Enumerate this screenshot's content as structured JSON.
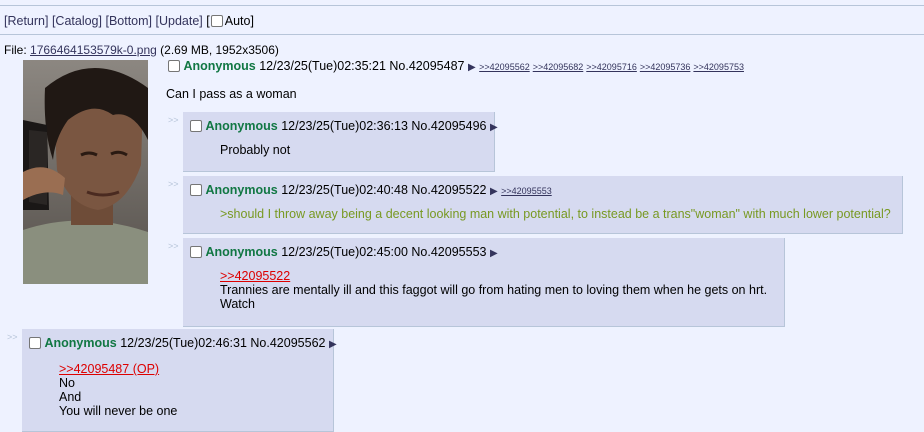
{
  "nav": {
    "return": "[Return]",
    "catalog": "[Catalog]",
    "bottom": "[Bottom]",
    "update": "[Update]",
    "auto_open": "[",
    "auto_label": "Auto]"
  },
  "file": {
    "prefix": "File:",
    "name": "1766464153579k-0.png",
    "meta": "(2.69 MB, 1952x3506)"
  },
  "op": {
    "name": "Anonymous",
    "datetime": "12/23/25(Tue)02:35:21",
    "number": "No.42095487",
    "backlinks": [
      ">>42095562",
      ">>42095682",
      ">>42095716",
      ">>42095736",
      ">>42095753"
    ],
    "message": "Can I pass as a woman"
  },
  "replies": [
    {
      "name": "Anonymous",
      "datetime": "12/23/25(Tue)02:36:13",
      "number": "No.42095496",
      "lines": [
        "Probably not"
      ]
    },
    {
      "name": "Anonymous",
      "datetime": "12/23/25(Tue)02:40:48",
      "number": "No.42095522",
      "backlink": ">>42095553",
      "quote": ">should I throw away being a decent looking man with potential, to instead be a trans\"woman\" with much lower potential?"
    },
    {
      "name": "Anonymous",
      "datetime": "12/23/25(Tue)02:45:00",
      "number": "No.42095553",
      "quotelink": ">>42095522",
      "lines": [
        "Trannies are mentally ill and this faggot will go from hating men to loving them when he gets on hrt.",
        "Watch"
      ]
    },
    {
      "name": "Anonymous",
      "datetime": "12/23/25(Tue)02:46:31",
      "number": "No.42095562",
      "quotelink": ">>42095487 (OP)",
      "lines": [
        "No",
        "And",
        "You will never be one"
      ]
    }
  ],
  "side_arrow": ">>",
  "arrow_glyph": "▶",
  "icons": [
    "checkbox-icon",
    "post-menu-arrow-icon"
  ]
}
